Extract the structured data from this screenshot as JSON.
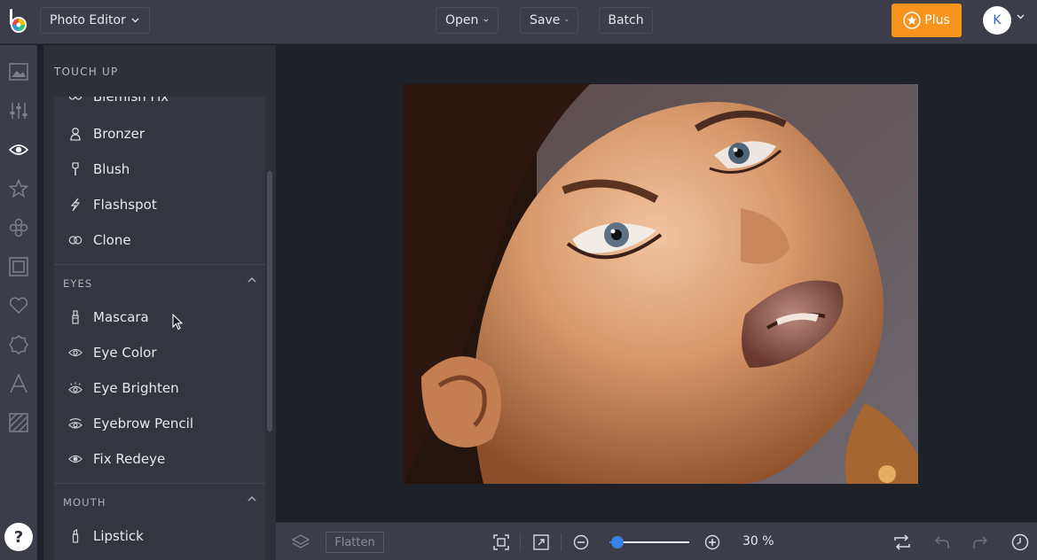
{
  "header": {
    "app_menu_label": "Photo Editor",
    "open_label": "Open",
    "save_label": "Save",
    "batch_label": "Batch",
    "plus_label": "Plus",
    "avatar_initial": "K"
  },
  "rail": {
    "icons": [
      "image-icon",
      "sliders-icon",
      "eye-icon",
      "star-icon",
      "flower-icon",
      "frame-icon",
      "heart-icon",
      "badge-icon",
      "text-icon",
      "texture-icon"
    ],
    "active_index": 2,
    "help_label": "?"
  },
  "panel": {
    "title": "TOUCH UP",
    "touchup_items": [
      {
        "label": "Blemish Fix",
        "icon": "blemish-icon"
      },
      {
        "label": "Bronzer",
        "icon": "bronzer-icon"
      },
      {
        "label": "Blush",
        "icon": "blush-brush-icon"
      },
      {
        "label": "Flashspot",
        "icon": "flashspot-icon"
      },
      {
        "label": "Clone",
        "icon": "clone-icon"
      }
    ],
    "eyes": {
      "title": "EYES",
      "items": [
        {
          "label": "Mascara",
          "icon": "mascara-icon"
        },
        {
          "label": "Eye Color",
          "icon": "eye-color-icon"
        },
        {
          "label": "Eye Brighten",
          "icon": "eye-brighten-icon"
        },
        {
          "label": "Eyebrow Pencil",
          "icon": "eyebrow-pencil-icon"
        },
        {
          "label": "Fix Redeye",
          "icon": "redeye-icon"
        }
      ]
    },
    "mouth": {
      "title": "MOUTH",
      "items": [
        {
          "label": "Lipstick",
          "icon": "lipstick-icon"
        }
      ]
    }
  },
  "bottom": {
    "flatten_label": "Flatten",
    "zoom_text": "30 %",
    "zoom_fraction": 0.1
  },
  "colors": {
    "accent": "#3b82e8",
    "plus": "#f8941d"
  }
}
